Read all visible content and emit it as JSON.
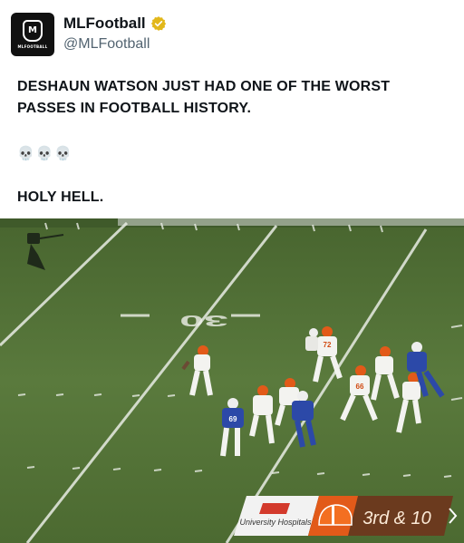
{
  "post": {
    "display_name": "MLFootball",
    "handle": "@MLFootball",
    "avatar_text": "MLFOOTBALL",
    "avatar_initial": "M",
    "line1": "DESHAUN WATSON JUST HAD ONE OF THE WORST PASSES IN FOOTBALL HISTORY.",
    "skulls": "💀💀💀",
    "line2": "HOLY HELL."
  },
  "video": {
    "yard_number": "30",
    "jersey_numbers": [
      "72",
      "66",
      "69"
    ],
    "sponsor": "University Hospitals",
    "down_distance": "3rd & 10"
  },
  "colors": {
    "verified_gold": "#e2b719",
    "handle_gray": "#536471",
    "field_green": "#55733a",
    "browns_orange": "#e25a19",
    "colts_blue": "#2c49a8"
  },
  "icons": [
    "verified-badge-icon",
    "shield-logo-icon",
    "browns-helmet-icon"
  ]
}
